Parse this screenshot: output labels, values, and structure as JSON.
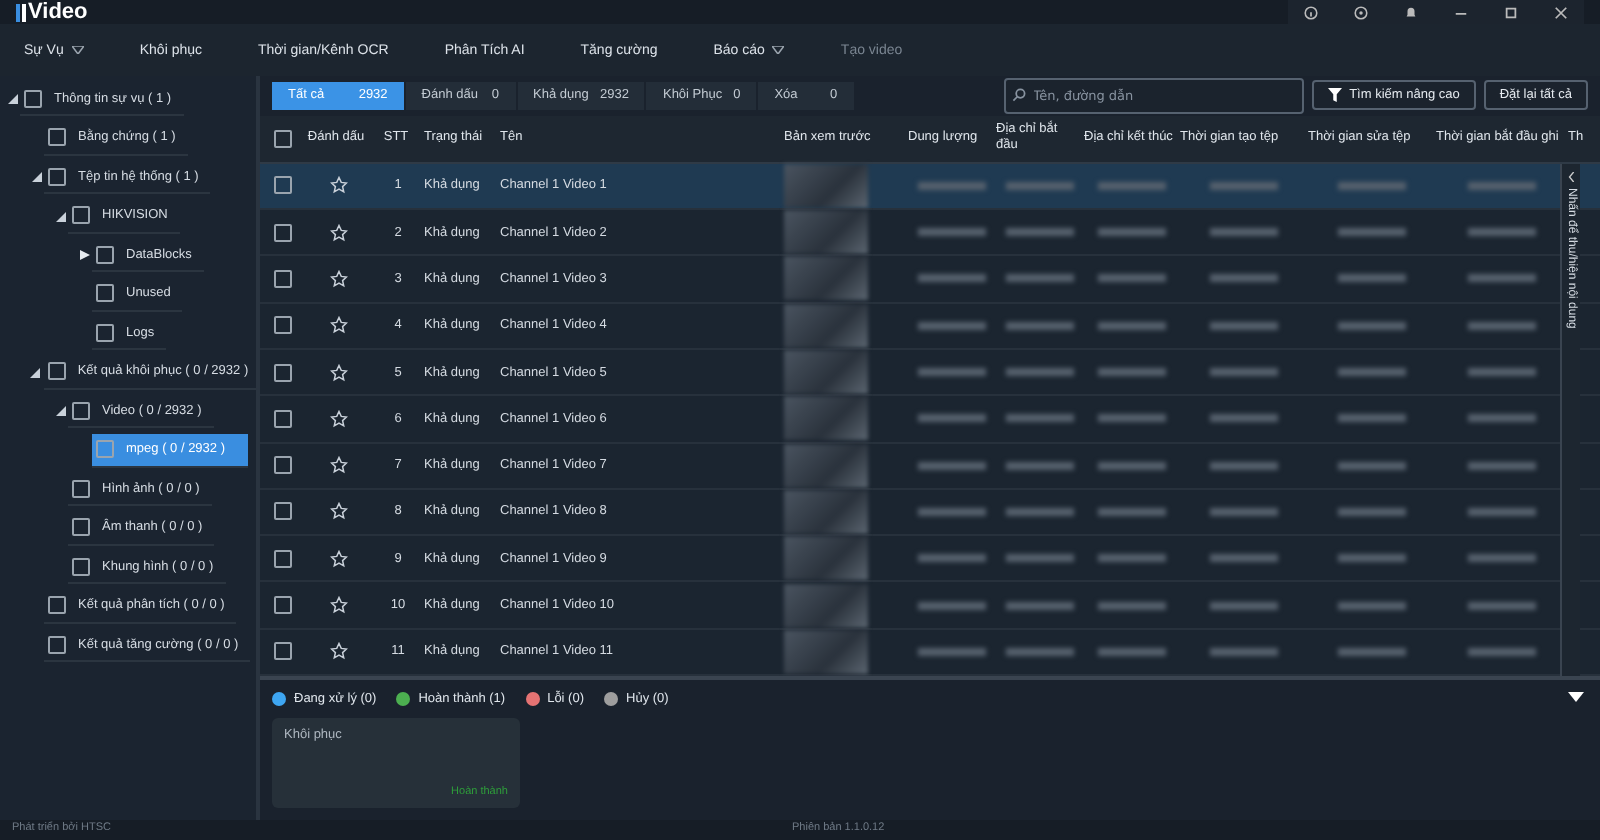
{
  "window": {
    "title": "Video"
  },
  "menu": [
    {
      "label": "Sự Vụ",
      "dropdown": true,
      "disabled": false
    },
    {
      "label": "Khôi phục",
      "dropdown": false,
      "disabled": false
    },
    {
      "label": "Thời gian/Kênh OCR",
      "dropdown": false,
      "disabled": false
    },
    {
      "label": "Phân Tích AI",
      "dropdown": false,
      "disabled": false
    },
    {
      "label": "Tăng cường",
      "dropdown": false,
      "disabled": false
    },
    {
      "label": "Báo cáo",
      "dropdown": true,
      "disabled": false
    },
    {
      "label": "Tạo video",
      "dropdown": false,
      "disabled": true
    }
  ],
  "sidebar": {
    "tree": [
      {
        "label": "Thông tin sự vụ ( 1 )",
        "expanded": true,
        "selected": false,
        "checked": false,
        "children": [
          {
            "label": "Bằng chứng ( 1 )",
            "selected": false,
            "checked": false
          },
          {
            "label": "Tệp tin hệ thống ( 1 )",
            "expanded": true,
            "selected": false,
            "checked": false,
            "children": [
              {
                "label": "HIKVISION",
                "expanded": true,
                "selected": false,
                "checked": false,
                "children": [
                  {
                    "label": "DataBlocks",
                    "expandable": true,
                    "expanded": false,
                    "selected": false,
                    "checked": false
                  },
                  {
                    "label": "Unused",
                    "selected": false,
                    "checked": false
                  },
                  {
                    "label": "Logs",
                    "selected": false,
                    "checked": false
                  }
                ]
              }
            ]
          },
          {
            "label": "Kết quả khôi phục ( 0 / 2932 )",
            "expanded": true,
            "selected": false,
            "checked": false,
            "children": [
              {
                "label": "Video ( 0 / 2932 )",
                "expanded": true,
                "selected": false,
                "checked": false,
                "children": [
                  {
                    "label": "mpeg ( 0 / 2932 )",
                    "selected": true,
                    "checked": false
                  }
                ]
              },
              {
                "label": "Hình ảnh ( 0 / 0 )",
                "selected": false,
                "checked": false
              },
              {
                "label": "Âm thanh ( 0 / 0 )",
                "selected": false,
                "checked": false
              },
              {
                "label": "Khung hình ( 0 / 0 )",
                "selected": false,
                "checked": false
              }
            ]
          },
          {
            "label": "Kết quả phân tích ( 0 / 0 )",
            "selected": false,
            "checked": false
          },
          {
            "label": "Kết quả tăng cường ( 0 / 0 )",
            "selected": false,
            "checked": false
          }
        ]
      }
    ]
  },
  "filters": [
    {
      "label": "Tất cả",
      "count": "2932",
      "selected": true
    },
    {
      "label": "Đánh dấu",
      "count": "0",
      "selected": false
    },
    {
      "label": "Khả dụng",
      "count": "2932",
      "selected": false
    },
    {
      "label": "Khôi Phục",
      "count": "0",
      "selected": false
    },
    {
      "label": "Xóa",
      "count": "0",
      "selected": false
    }
  ],
  "search": {
    "placeholder": "Tên, đường dẫn"
  },
  "buttons": {
    "advanced": "Tìm kiếm nâng cao",
    "reset": "Đặt lại tất cả"
  },
  "table": {
    "select_all_checked": false,
    "columns": [
      "Đánh dấu",
      "STT",
      "Trạng thái",
      "Tên",
      "Bản xem trước",
      "Dung lượng",
      "Địa chỉ bắt đầu",
      "Địa chỉ kết thúc",
      "Thời gian tạo tệp",
      "Thời gian sửa tệp",
      "Thời gian bắt đầu ghi",
      "Th"
    ],
    "rows": [
      {
        "stt": "1",
        "status": "Khả dụng",
        "name": "Channel 1 Video 1",
        "selected": true,
        "checked": false,
        "starred": false
      },
      {
        "stt": "2",
        "status": "Khả dụng",
        "name": "Channel 1 Video 2",
        "selected": false,
        "checked": false,
        "starred": false
      },
      {
        "stt": "3",
        "status": "Khả dụng",
        "name": "Channel 1 Video 3",
        "selected": false,
        "checked": false,
        "starred": false
      },
      {
        "stt": "4",
        "status": "Khả dụng",
        "name": "Channel 1 Video 4",
        "selected": false,
        "checked": false,
        "starred": false
      },
      {
        "stt": "5",
        "status": "Khả dụng",
        "name": "Channel 1 Video 5",
        "selected": false,
        "checked": false,
        "starred": false
      },
      {
        "stt": "6",
        "status": "Khả dụng",
        "name": "Channel 1 Video 6",
        "selected": false,
        "checked": false,
        "starred": false
      },
      {
        "stt": "7",
        "status": "Khả dụng",
        "name": "Channel 1 Video 7",
        "selected": false,
        "checked": false,
        "starred": false
      },
      {
        "stt": "8",
        "status": "Khả dụng",
        "name": "Channel 1 Video 8",
        "selected": false,
        "checked": false,
        "starred": false
      },
      {
        "stt": "9",
        "status": "Khả dụng",
        "name": "Channel 1 Video 9",
        "selected": false,
        "checked": false,
        "starred": false
      },
      {
        "stt": "10",
        "status": "Khả dụng",
        "name": "Channel 1 Video 10",
        "selected": false,
        "checked": false,
        "starred": false
      },
      {
        "stt": "11",
        "status": "Khả dụng",
        "name": "Channel 1 Video 11",
        "selected": false,
        "checked": false,
        "starred": false
      }
    ]
  },
  "side_toggle": {
    "label": "Nhấn để thu/hiện nội dung"
  },
  "task_legend": [
    {
      "label": "Đang xử lý (0)",
      "color": "#3ea6f2"
    },
    {
      "label": "Hoàn thành (1)",
      "color": "#4caf50"
    },
    {
      "label": "Lỗi (0)",
      "color": "#e57373"
    },
    {
      "label": "Hủy (0)",
      "color": "#9e9e9e"
    }
  ],
  "tasks": [
    {
      "title": "Khôi phục",
      "status": "Hoàn thành"
    }
  ],
  "status_bar": {
    "left": "Phát triển bởi HTSC",
    "center": "Phiên bản 1.1.0.12"
  }
}
